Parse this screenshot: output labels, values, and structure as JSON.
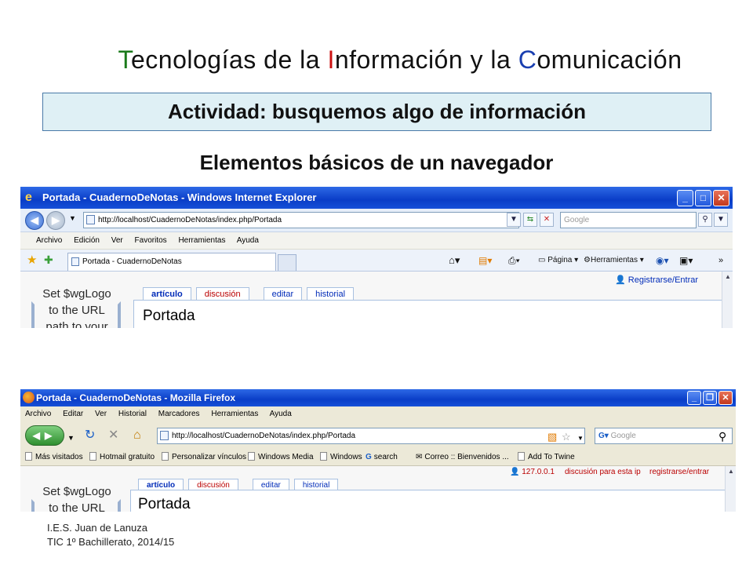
{
  "slide": {
    "title_parts": [
      {
        "text": "T",
        "color": "#1a7a1a"
      },
      {
        "text": "ecnologías de la ",
        "color": "#111111"
      },
      {
        "text": "I",
        "color": "#cc1111"
      },
      {
        "text": "nformación y la ",
        "color": "#111111"
      },
      {
        "text": "C",
        "color": "#1a3fb0"
      },
      {
        "text": "omunicación",
        "color": "#111111"
      }
    ],
    "activity": "Actividad: busquemos algo de información",
    "subtitle": "Elementos básicos de un navegador",
    "footer_line1": "I.E.S. Juan de Lanuza",
    "footer_line2": "TIC 1º Bachillerato, 2014/15"
  },
  "ie": {
    "window_title": "Portada - CuadernoDeNotas - Windows Internet Explorer",
    "address": "http://localhost/CuadernoDeNotas/index.php/Portada",
    "search_placeholder": "Google",
    "menu": [
      "Archivo",
      "Edición",
      "Ver",
      "Favoritos",
      "Herramientas",
      "Ayuda"
    ],
    "tab_label": "Portada - CuadernoDeNotas",
    "cmd_page": "Página",
    "cmd_tools": "Herramientas",
    "user_link": "Registrarse/Entrar",
    "wiki_tabs": [
      "artículo",
      "discusión",
      "editar",
      "historial"
    ],
    "logo_text": [
      "Set $wgLogo",
      "to the URL",
      "path to your"
    ],
    "page_title": "Portada"
  },
  "ff": {
    "window_title": "Portada - CuadernoDeNotas - Mozilla Firefox",
    "menu": [
      "Archivo",
      "Editar",
      "Ver",
      "Historial",
      "Marcadores",
      "Herramientas",
      "Ayuda"
    ],
    "address": "http://localhost/CuadernoDeNotas/index.php/Portada",
    "search_placeholder": "Google",
    "bookmarks": [
      "Más visitados",
      "Hotmail gratuito",
      "Personalizar vínculos",
      "Windows Media",
      "Windows",
      "search",
      "Correo :: Bienvenidos ...",
      "Add To Twine"
    ],
    "user_ip": "127.0.0.1",
    "user_talk": "discusión para esta ip",
    "user_login": "registrarse/entrar",
    "wiki_tabs": [
      "artículo",
      "discusión",
      "editar",
      "historial"
    ],
    "logo_text": [
      "Set $wgLogo",
      "to the URL"
    ],
    "page_title": "Portada"
  }
}
